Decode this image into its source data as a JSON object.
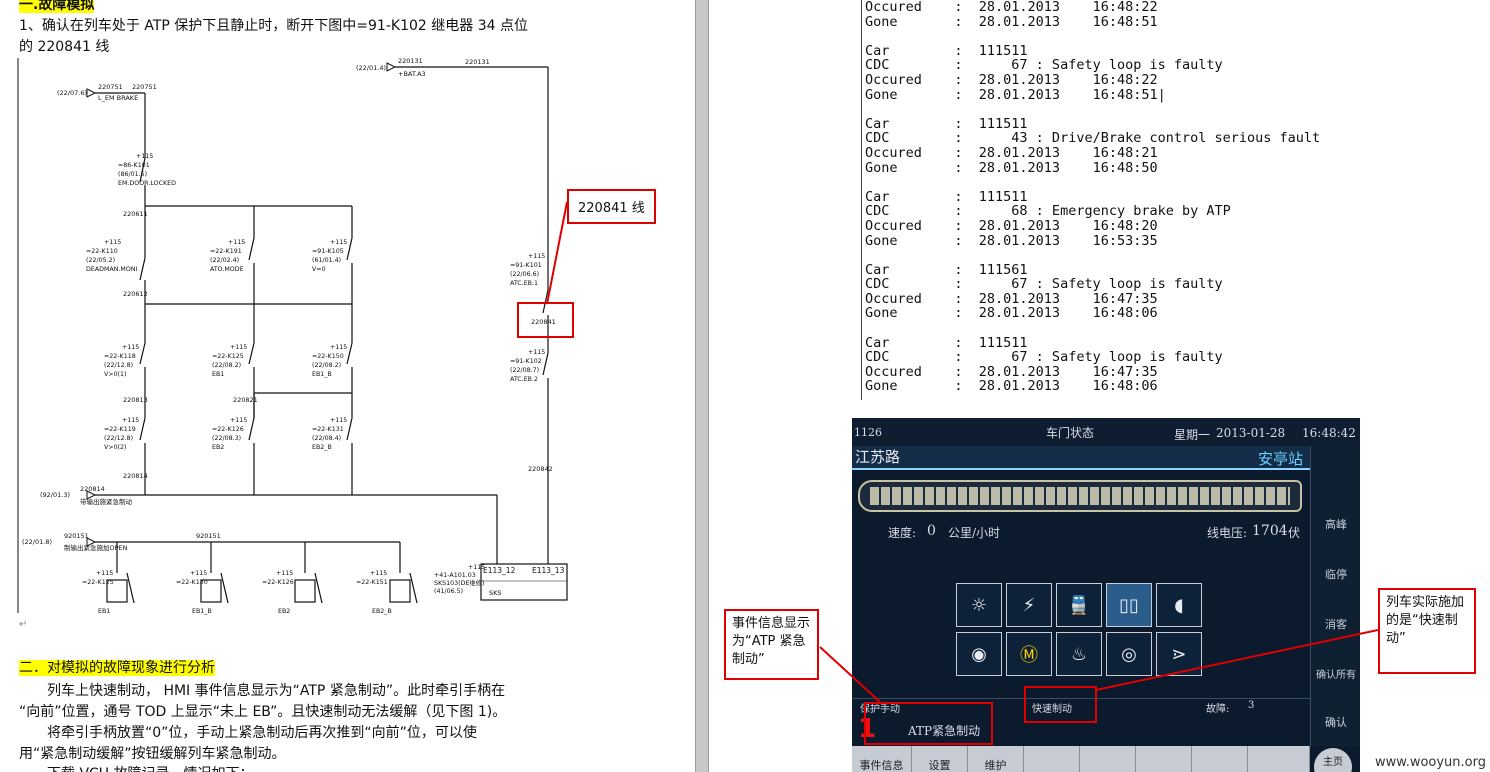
{
  "left_page": {
    "section1_heading": "一.故障模拟",
    "step1_line1": "1、确认在列车处于 ATP 保护下且静止时，断开下图中=91-K102 继电器 34 点位",
    "step1_line2": "的 220841 线",
    "callout_220841": "220841 线",
    "section2_heading": "二．对模拟的故障现象进行分析",
    "para1_line1": "列车上快速制动，  HMI 事件信息显示为“ATP 紧急制动”。此时牵引手柄在",
    "para1_line2": "“向前”位置，通号 TOD 上显示“未上 EB”。且快速制动无法缓解（见下图 1)。",
    "para2_line1": "将牵引手柄放置“0”位，手动上紧急制动后再次推到“向前”位，可以使",
    "para2_line2": "用“紧急制动缓解”按钮缓解列车紧急制动。",
    "para3_partial": "下载 VCU 故障记录，情况如下："
  },
  "schematic": {
    "top_ref": "(22/01.4)",
    "top_wire": "220131",
    "top_bus": "+BAT.A3",
    "top_right_wire": "220131",
    "em_brake_ref": "(22/07.6)",
    "em_brake_wire": "220751",
    "em_brake_wire2": "220751",
    "em_brake_label": "L_EM BRAKE",
    "k101a": [
      "+115",
      "=86-K101",
      "(86/01.5)",
      "EM.DOOR.LOCKED"
    ],
    "w220611": "220611",
    "k110": [
      "+115",
      "=22-K110",
      "(22/05.2)",
      "DEADMAN.MONI"
    ],
    "k191": [
      "+115",
      "=22-K191",
      "(22/02.4)",
      "ATO.MODE"
    ],
    "k105": [
      "+115",
      "=91-K105",
      "(61/01.4)",
      "V=0"
    ],
    "w220612": "220612",
    "k101b": [
      "+115",
      "=91-K101",
      "(22/06.6)",
      "ATC.EB.1"
    ],
    "w220841": "220841",
    "k118": [
      "+115",
      "=22-K118",
      "(22/12.8)",
      "V>0(1)"
    ],
    "k125": [
      "+115",
      "=22-K125",
      "(22/08.2)",
      "EB1"
    ],
    "k150": [
      "+115",
      "=22-K150",
      "(22/08.2)",
      "EB1_B"
    ],
    "w220813": "220813",
    "w220821": "220821",
    "k102": [
      "+115",
      "=91-K102",
      "(22/08.7)",
      "ATC.EB.2"
    ],
    "k119": [
      "+115",
      "=22-K119",
      "(22/12.8)",
      "V>0(2)"
    ],
    "k126": [
      "+115",
      "=22-K126",
      "(22/08.3)",
      "EB2"
    ],
    "k151": [
      "+115",
      "=22-K131",
      "(22/08.4)",
      "EB2_B"
    ],
    "w220814": "220814",
    "w220842": "220842",
    "bottom_ref": "(92/01.3)",
    "bottom_wire": "220814",
    "bottom_label": "带输出施紧急制动",
    "open_ref": "(22/01.8)",
    "open_wire": "920151",
    "open_label": "制输出紧急施加OPEN",
    "w920151b": "920151",
    "coils": [
      [
        "+115",
        "=22-K125",
        "EB1"
      ],
      [
        "+115",
        "=22-K130",
        "EB1_B"
      ],
      [
        "+115",
        "=22-K126",
        "EB2"
      ],
      [
        "+115",
        "=22-K151",
        "EB2_B"
      ]
    ],
    "sks_box": [
      "+115",
      "+41-A101.03",
      "SKS103(DE维修)",
      "(41/06.5)"
    ],
    "sks_e1": "E113_12",
    "sks_e2": "E113_13",
    "sks_name": "SKS"
  },
  "right_page": {
    "log_text": "Occured    :  28.01.2013    16:48:22\nGone       :  28.01.2013    16:48:51\n\nCar        :  111511\nCDC        :      67 : Safety loop is faulty\nOccured    :  28.01.2013    16:48:22\nGone       :  28.01.2013    16:48:51|\n\nCar        :  111511\nCDC        :      43 : Drive/Brake control serious fault\nOccured    :  28.01.2013    16:48:21\nGone       :  28.01.2013    16:48:50\n\nCar        :  111511\nCDC        :      68 : Emergency brake by ATP\nOccured    :  28.01.2013    16:48:20\nGone       :  28.01.2013    16:53:35\n\nCar        :  111561\nCDC        :      67 : Safety loop is faulty\nOccured    :  28.01.2013    16:47:35\nGone       :  28.01.2013    16:48:06\n\nCar        :  111511\nCDC        :      67 : Safety loop is faulty\nOccured    :  28.01.2013    16:47:35\nGone       :  28.01.2013    16:48:06",
    "callout_event": "事件信息显示为“ATP 紧急制动”",
    "callout_actual": "列车实际施加的是“快速制动”"
  },
  "hmi": {
    "id": "1126",
    "title": "车门状态",
    "weekday": "星期一",
    "date": "2013-01-28",
    "time": "16:48:42",
    "station_from": "江苏路",
    "station_to": "安亭站",
    "speed_label": "速度:",
    "speed_value": "0",
    "speed_unit": "公里/小时",
    "voltage_label": "线电压:",
    "voltage_value": "1704",
    "voltage_unit": "伏",
    "side_buttons": [
      "高峰",
      "临停",
      "消客",
      "确认所有",
      "确认"
    ],
    "status_left": "保护手动",
    "status_mid": "快速制动",
    "fault_label": "故障:",
    "fault_count": "3",
    "event_number": "1",
    "event_text": "ATP紧急制动",
    "bottom_tabs": [
      "事件信息",
      "设置",
      "维护"
    ],
    "home_button": "主页",
    "icons": [
      "aux-power-icon",
      "converter-icon",
      "train-icon",
      "door-icon",
      "audio-icon",
      "brake-icon",
      "motor-icon",
      "fire-icon",
      "compressor-icon",
      "pantograph-icon"
    ]
  },
  "watermark": "www.wooyun.org"
}
